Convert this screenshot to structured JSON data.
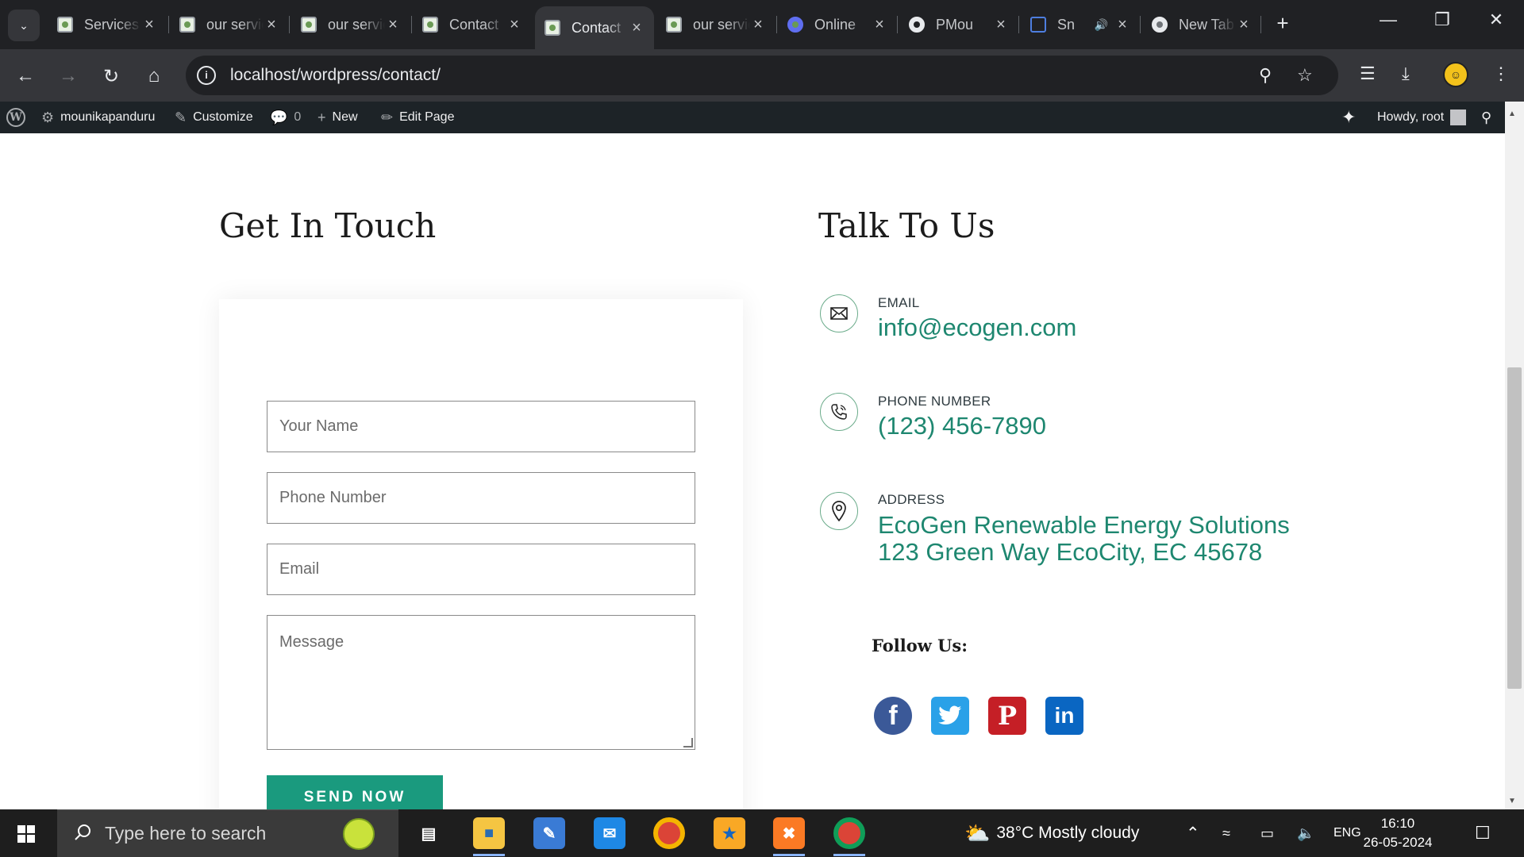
{
  "browser": {
    "tabs": [
      {
        "label": "Services",
        "favicon": "site"
      },
      {
        "label": "our services",
        "favicon": "site"
      },
      {
        "label": "our services",
        "favicon": "site"
      },
      {
        "label": "Contact",
        "favicon": "site"
      },
      {
        "label": "Contact",
        "favicon": "site",
        "active": true
      },
      {
        "label": "our services",
        "favicon": "site"
      },
      {
        "label": "Online",
        "favicon": "online"
      },
      {
        "label": "PMou",
        "favicon": "github"
      },
      {
        "label": "Sn",
        "favicon": "snip"
      },
      {
        "label": "New Tab",
        "favicon": "chrome"
      }
    ],
    "url": "localhost/wordpress/contact/",
    "colors": {
      "frame": "#202124",
      "toolbar": "#35363a"
    }
  },
  "adminbar": {
    "site_name": "mounikapanduru",
    "customize": "Customize",
    "comments_count": "0",
    "new": "New",
    "edit_page": "Edit Page",
    "howdy": "Howdy, root"
  },
  "contact_page": {
    "form_heading": "Get In Touch",
    "info_heading": "Talk To Us",
    "form": {
      "name_placeholder": "Your Name",
      "phone_placeholder": "Phone Number",
      "email_placeholder": "Email",
      "message_placeholder": "Message",
      "submit_label": "SEND NOW"
    },
    "contacts": [
      {
        "label": "EMAIL",
        "value": "info@ecogen.com",
        "icon": "envelope-icon"
      },
      {
        "label": "PHONE NUMBER",
        "value": "(123) 456-7890",
        "icon": "phone-icon"
      },
      {
        "label": "ADDRESS",
        "value_line1": "EcoGen Renewable Energy Solutions",
        "value_line2": "123 Green Way EcoCity, EC 45678",
        "icon": "map-pin-icon"
      }
    ],
    "follow_label": "Follow Us:",
    "social": [
      "facebook-icon",
      "twitter-icon",
      "pinterest-icon",
      "linkedin-icon"
    ],
    "colors": {
      "accent": "#1a9a7e",
      "link": "#1e8770"
    }
  },
  "taskbar": {
    "search_placeholder": "Type here to search",
    "weather": "38°C  Mostly cloudy",
    "language": "ENG",
    "time": "16:10",
    "date": "26-05-2024"
  }
}
